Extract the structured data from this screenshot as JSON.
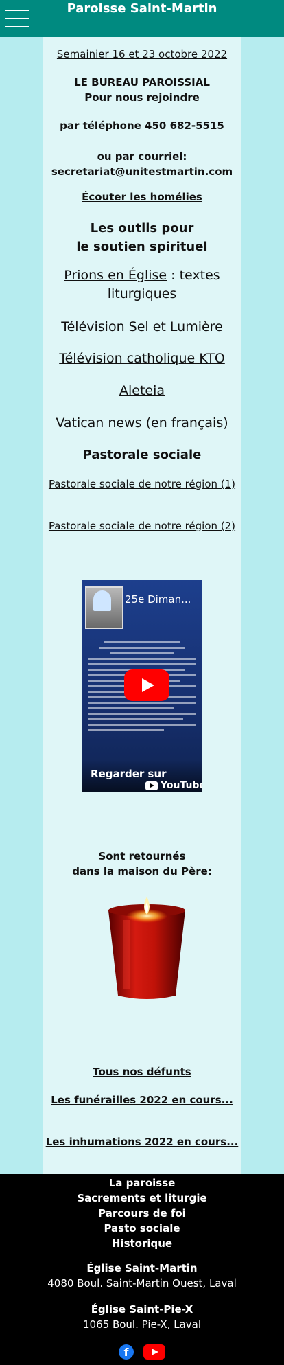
{
  "header": {
    "title": "Paroisse Saint-Martin",
    "menu_icon": "hamburger-menu-icon"
  },
  "main": {
    "semainier": "Semainier 16 et 23 octobre 2022",
    "bureau_title": "LE BUREAU PAROISSIAL",
    "bureau_subtitle": "Pour nous rejoindre",
    "phone_label": "par téléphone ",
    "phone_number": "450 682-5515",
    "email_label": "ou par courriel:",
    "email_address": "secretariat@unitestmartin.com",
    "homelies_link": "Écouter les homélies",
    "outils_line1": "Les outils pour",
    "outils_line2": "le soutien spirituel",
    "prions_link": "Prions en Église",
    "prions_suffix": " : textes liturgiques",
    "tsl_link": "Télévision Sel et Lumière",
    "kto_link": "Télévision catholique KTO",
    "aleteia_link": "Aleteia",
    "vatican_link": "Vatican news (en français)",
    "pastorale_title": "Pastorale sociale",
    "pastorale_link1": "Pastorale sociale de notre région (1)",
    "pastorale_link2": "Pastorale sociale de notre région (2)",
    "video": {
      "title": "25e Diman...",
      "watch_label": "Regarder sur",
      "platform": "YouTube"
    },
    "retournes_line1": "Sont retournés",
    "retournes_line2": "dans la maison du Père:",
    "defunts_link": "Tous nos défunts ",
    "funerailles_link": "Les funérailles 2022 en cours...",
    "inhumations_link": "Les inhumations 2022 en cours..."
  },
  "footer": {
    "nav": [
      "La paroisse",
      "Sacrements et liturgie",
      "Parcours de foi",
      "Pasto sociale",
      "Historique"
    ],
    "church1_name": "Église Saint-Martin",
    "church1_address": "4080 Boul. Saint-Martin Ouest, Laval",
    "church2_name": "Église Saint-Pie-X",
    "church2_address": "1065 Boul. Pie-X, Laval",
    "facebook_letter": "f"
  },
  "colors": {
    "header": "#008a80",
    "background": "#b6ecef",
    "column": "#dff6f7",
    "footer": "#000000",
    "youtube_red": "#ff0000",
    "facebook_blue": "#1877f2"
  }
}
